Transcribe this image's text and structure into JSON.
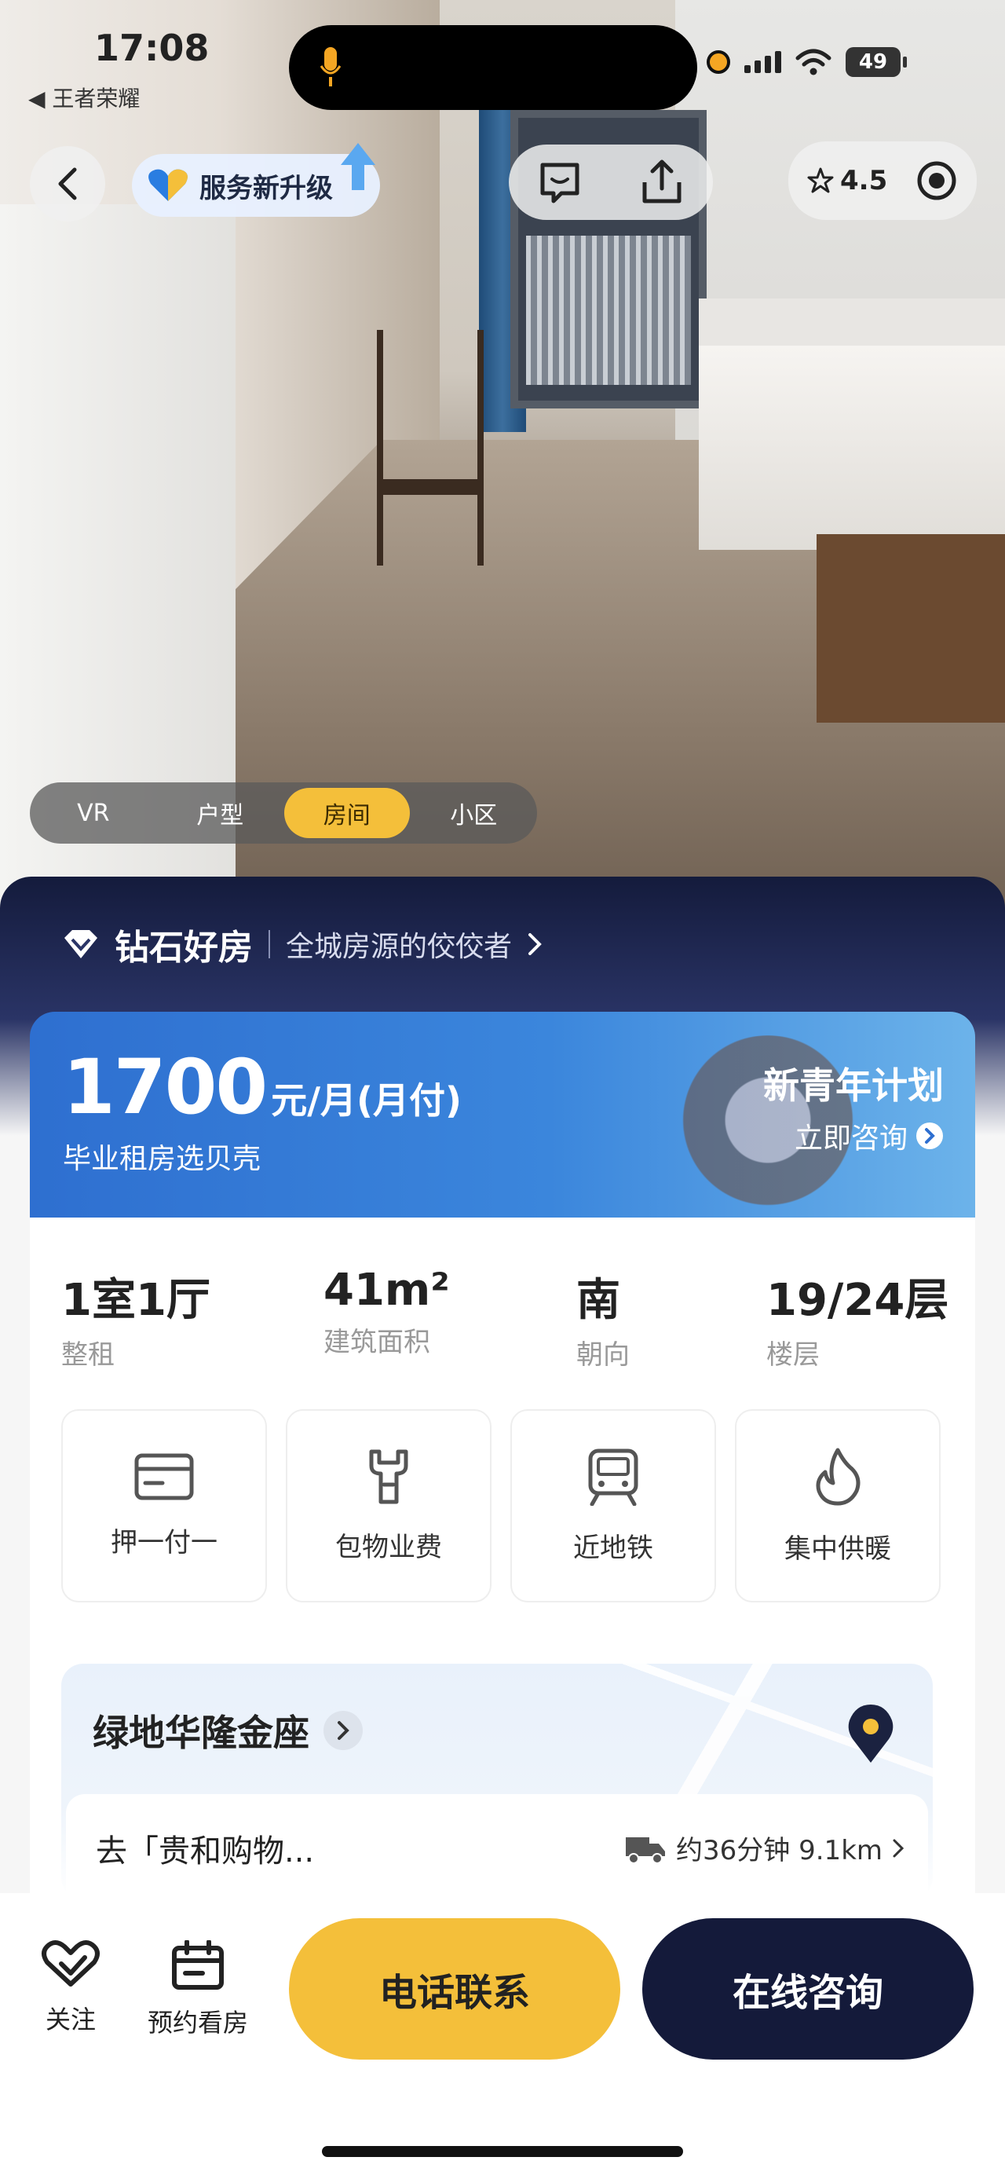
{
  "status_bar": {
    "time": "17:08",
    "back_app": "◀ 王者荣耀",
    "battery": "49"
  },
  "header": {
    "upgrade_label": "服务新升级",
    "rating": "4.5"
  },
  "media_tabs": [
    {
      "label": "VR",
      "active": false
    },
    {
      "label": "户型",
      "active": false
    },
    {
      "label": "房间",
      "active": true
    },
    {
      "label": "小区",
      "active": false
    }
  ],
  "diamond": {
    "title": "钻石好房",
    "subtitle": "全城房源的佼佼者"
  },
  "price": {
    "amount": "1700",
    "unit": "元/月(月付)",
    "subtitle": "毕业租房选贝壳",
    "plan_title": "新青年计划",
    "plan_link": "立即咨询"
  },
  "stats": [
    {
      "value": "1室1厅",
      "label": "整租"
    },
    {
      "value": "41m²",
      "label": "建筑面积"
    },
    {
      "value": "南",
      "label": "朝向"
    },
    {
      "value": "19/24层",
      "label": "楼层"
    }
  ],
  "features": [
    {
      "label": "押一付一",
      "icon": "card-icon"
    },
    {
      "label": "包物业费",
      "icon": "wrench-icon"
    },
    {
      "label": "近地铁",
      "icon": "subway-icon"
    },
    {
      "label": "集中供暖",
      "icon": "flame-icon"
    }
  ],
  "location": {
    "community": "绿地华隆金座",
    "commute_dest": "去「贵和购物...",
    "commute_time": "约36分钟 9.1km"
  },
  "bottom_bar": {
    "follow": "关注",
    "appointment": "预约看房",
    "call": "电话联系",
    "chat": "在线咨询"
  },
  "colors": {
    "accent_yellow": "#f4bf3a",
    "navy": "#141a3a",
    "price_blue": "#2e6fd0"
  }
}
